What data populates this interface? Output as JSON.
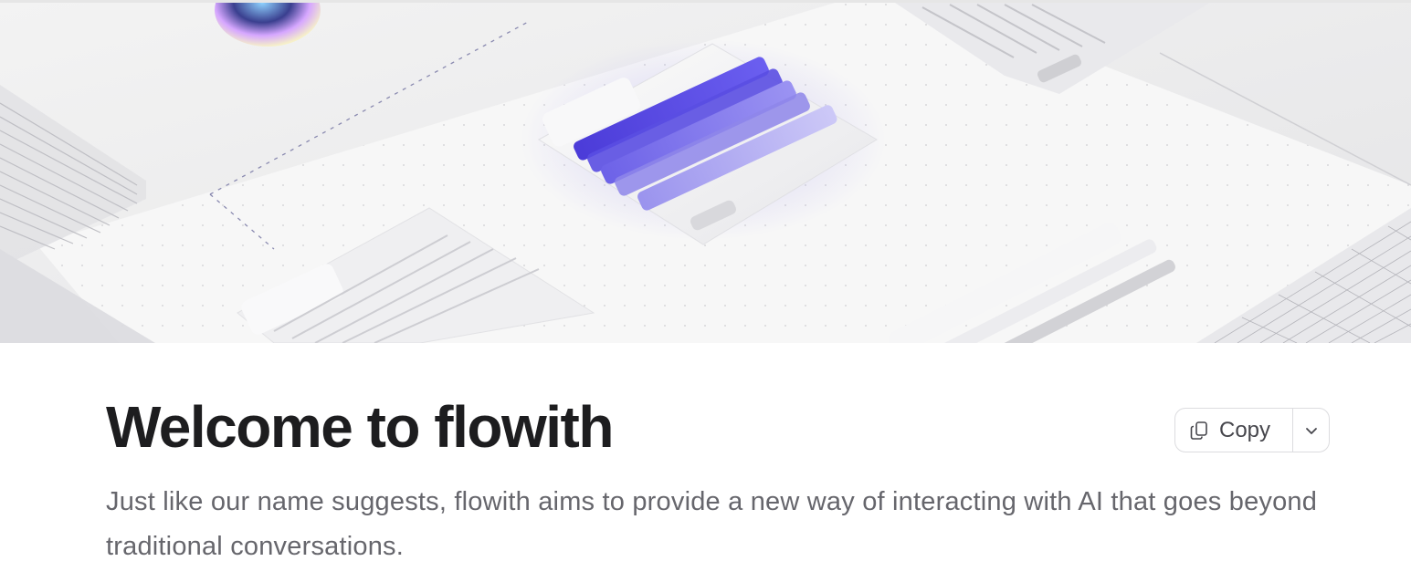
{
  "hero": {
    "alt": "decorative hero illustration"
  },
  "header": {
    "title": "Welcome to flowith",
    "subtitle": "Just like our name suggests, flowith aims to provide a new way of interacting with AI that goes beyond traditional conversations."
  },
  "actions": {
    "copy_label": "Copy",
    "copy_icon": "copy-icon",
    "dropdown_icon": "chevron-down-icon"
  },
  "colors": {
    "title": "#1d1d1f",
    "subtitle": "#66666c",
    "accent": "#5b4ee6",
    "border": "#dcdcdf"
  }
}
